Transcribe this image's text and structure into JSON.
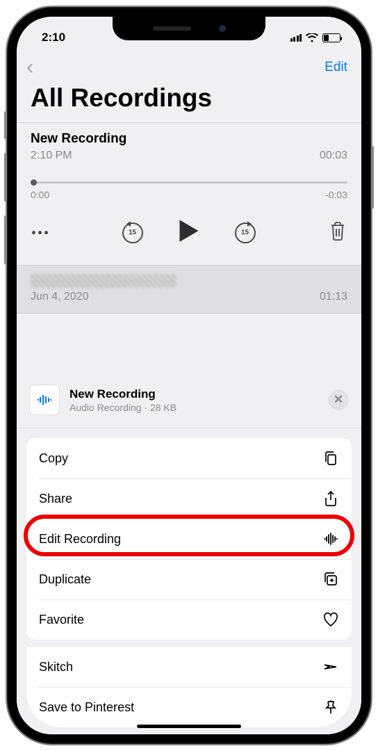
{
  "status": {
    "time": "2:10"
  },
  "nav": {
    "edit": "Edit"
  },
  "page": {
    "title": "All Recordings"
  },
  "recording1": {
    "title": "New Recording",
    "time": "2:10 PM",
    "duration": "00:03",
    "start": "0:00",
    "end": "-0:03"
  },
  "recording2": {
    "date": "Jun 4, 2020",
    "duration": "01:13"
  },
  "sheet": {
    "title": "New Recording",
    "subtitle": "Audio Recording · 28 KB",
    "actions": {
      "copy": "Copy",
      "share": "Share",
      "edit": "Edit Recording",
      "duplicate": "Duplicate",
      "favorite": "Favorite",
      "skitch": "Skitch",
      "pinterest": "Save to Pinterest"
    }
  },
  "skip": "15"
}
